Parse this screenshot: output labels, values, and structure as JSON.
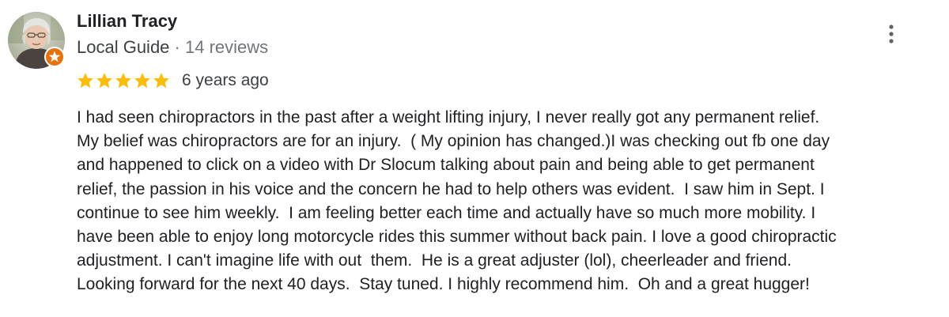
{
  "author": {
    "name": "Lillian Tracy",
    "badge": "Local Guide",
    "separator": "·",
    "reviews_count": "14 reviews",
    "badge_color": "#e8710a"
  },
  "rating": {
    "stars": 5,
    "max_stars": 5,
    "star_color": "#fbbc04",
    "date": "6 years ago"
  },
  "review": {
    "lines": [
      "I had seen chiropractors in the past after a weight lifting injury, I never really got any permanent relief.",
      "My belief was chiropractors are for an injury.  ( My opinion has changed.)I was checking out fb one day",
      "and happened to click on a video with Dr Slocum talking about pain and being able to get permanent",
      "relief, the passion in his voice and the concern he had to help others was evident.  I saw him in Sept. I",
      "continue to see him weekly.  I am feeling better each time and actually have so much more mobility. I",
      "have been able to enjoy long motorcycle rides this summer without back pain. I love a good chiropractic",
      "adjustment. I can't imagine life with out  them.  He is a great adjuster (lol), cheerleader and friend.",
      "Looking forward for the next 40 days.  Stay tuned. I highly recommend him.  Oh and a great hugger!"
    ]
  },
  "icons": {
    "more": "more-vert-icon",
    "star": "star-icon",
    "badge": "local-guide-badge-icon"
  }
}
